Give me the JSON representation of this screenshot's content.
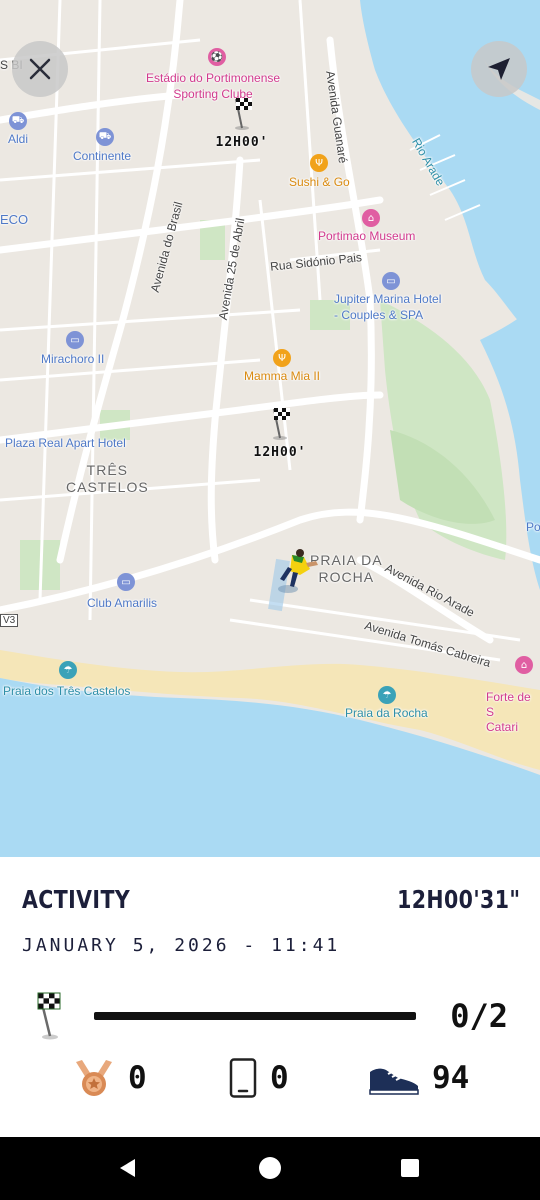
{
  "map": {
    "labels": {
      "stadium": "Estádio do Portimonense\nSporting Clube",
      "aldi": "Aldi",
      "continente": "Continente",
      "sushi": "Sushi & Go",
      "museum": "Portimao Museum",
      "rua_sidonio": "Rua Sidónio Pais",
      "jupiter": "Jupiter Marina Hotel\n- Couples & SPA",
      "mirachoro": "Mirachoro II",
      "mamma_mia": "Mamma Mia II",
      "plaza_real": "Plaza Real Apart Hotel",
      "tres_castelos": "TRÊS\nCASTELOS",
      "praia_da_rocha_district": "PRAIA DA\nROCHA",
      "club_amarilis": "Club Amarilis",
      "av_rio_arade": "Avenida Rio Arade",
      "av_tomas_cabreira": "Avenida Tomás Cabreira",
      "praia_tres_castelos": "Praia dos Três Castelos",
      "praia_da_rocha": "Praia da Rocha",
      "forte": "Forte de S\nCatari",
      "av_brasil": "Avenida do Brasil",
      "av_25_abril": "Avenida 25 de Abril",
      "av_guanare": "Avenida Guanaré",
      "rio_arade": "Rio Arade",
      "eco": "ECO",
      "s_bi": "S BI",
      "po": "Po",
      "v3": "V3"
    },
    "checkpoints": [
      {
        "time": "12H00'"
      },
      {
        "time": "12H00'"
      }
    ],
    "close_icon": "close-icon",
    "locate_icon": "navigation-arrow-icon"
  },
  "activity": {
    "title": "ACTIVITY",
    "duration": "12H00'31\"",
    "date": "JANUARY 5, 2026 - 11:41",
    "progress": {
      "count_text": "0/2",
      "fraction": 0.0,
      "icon": "checkered-flag-icon"
    },
    "stats": [
      {
        "icon": "medal-icon",
        "value": "0"
      },
      {
        "icon": "smartphone-icon",
        "value": "0"
      },
      {
        "icon": "sneaker-icon",
        "value": "94"
      }
    ]
  },
  "navbar": {
    "back_icon": "back-triangle-icon",
    "home_icon": "home-circle-icon",
    "recents_icon": "recents-square-icon"
  }
}
